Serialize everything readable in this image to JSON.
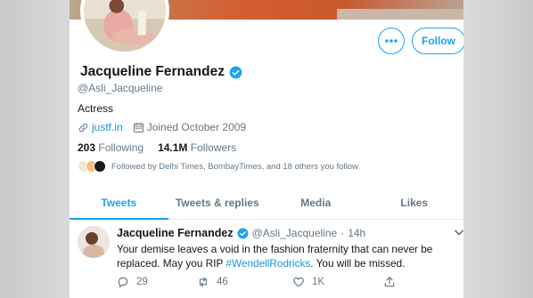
{
  "profile": {
    "name": "Jacqueline Fernandez",
    "handle": "@Asli_Jacqueline",
    "bio": "Actress",
    "website": "justf.in",
    "joined": "Joined October 2009",
    "following_count": "203",
    "following_label": "Following",
    "followers_count": "14.1M",
    "followers_label": "Followers",
    "followed_by": "Followed by Delhi Times, BombayTimes, and 18 others you follow"
  },
  "actions": {
    "follow_label": "Follow"
  },
  "tabs": [
    {
      "label": "Tweets",
      "active": true
    },
    {
      "label": "Tweets & replies",
      "active": false
    },
    {
      "label": "Media",
      "active": false
    },
    {
      "label": "Likes",
      "active": false
    }
  ],
  "tweet": {
    "name": "Jacqueline Fernandez",
    "handle": "@Asli_Jacqueline",
    "separator": "·",
    "time": "14h",
    "text_part1": "Your demise leaves a void in the fashion fraternity that can never be replaced. May you RIP ",
    "hashtag": "#WendellRodricks",
    "text_part2": ". You will be missed.",
    "replies": "29",
    "retweets": "46",
    "likes": "1K"
  },
  "icons": {
    "more": "more-dots-icon",
    "verified": "verified-badge-icon",
    "link": "link-icon",
    "calendar": "calendar-icon",
    "reply": "reply-icon",
    "retweet": "retweet-icon",
    "like": "heart-icon",
    "share": "share-icon",
    "caret": "chevron-down-icon"
  },
  "colors": {
    "accent": "#1da1f2",
    "link": "#1b95e0",
    "muted": "#657786",
    "text": "#14171a"
  }
}
